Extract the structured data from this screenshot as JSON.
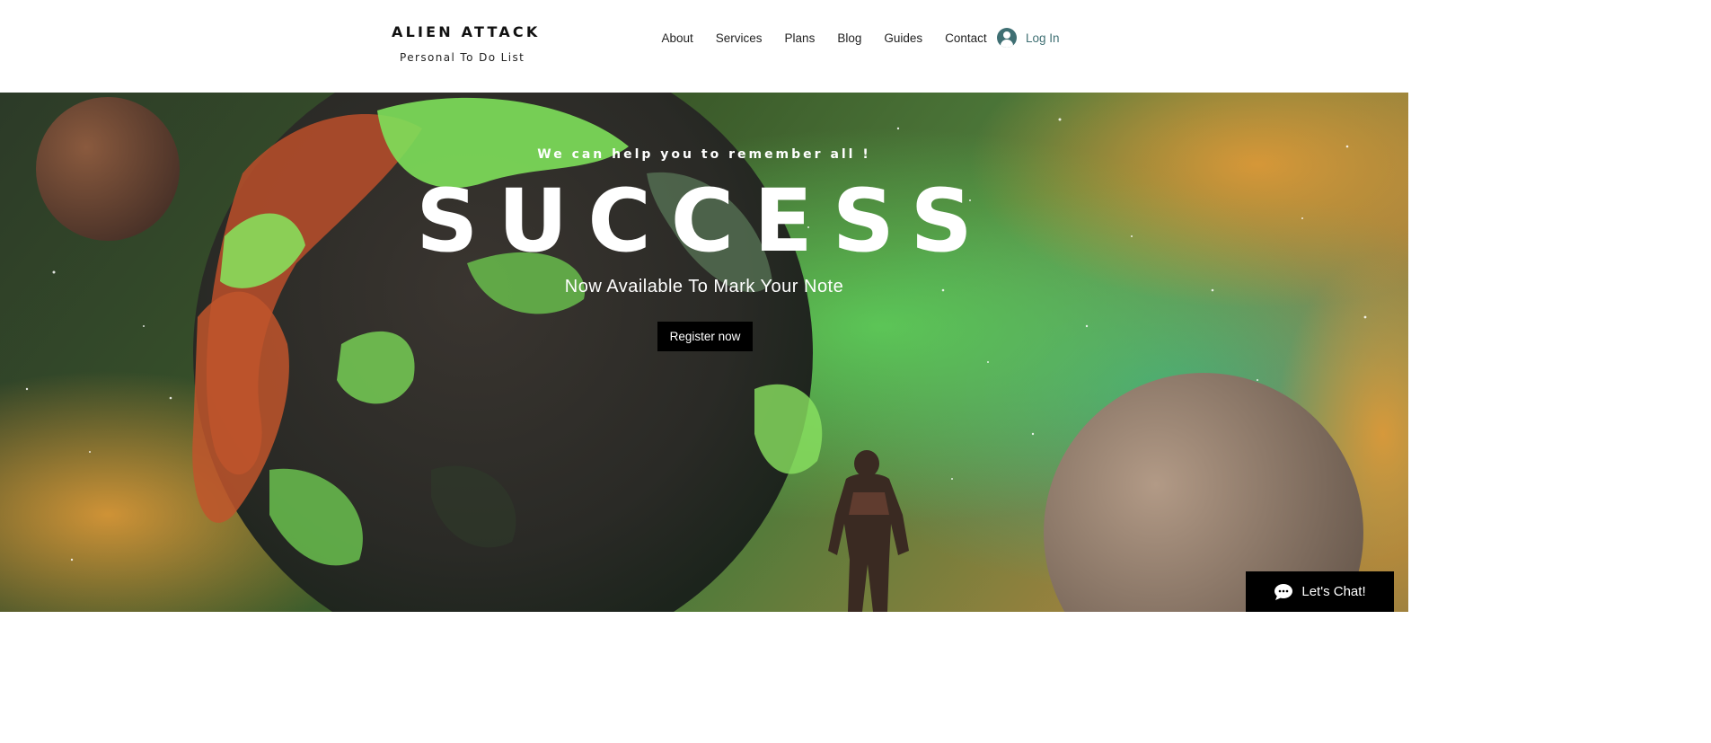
{
  "brand": {
    "title": "ALIEN ATTACK",
    "subtitle": "Personal To Do List"
  },
  "nav": {
    "items": [
      {
        "label": "About"
      },
      {
        "label": "Services"
      },
      {
        "label": "Plans"
      },
      {
        "label": "Blog"
      },
      {
        "label": "Guides"
      },
      {
        "label": "Contact"
      }
    ],
    "login_label": "Log In",
    "login_icon": "user-avatar-icon"
  },
  "hero": {
    "tagline": "We can help you to remember all !",
    "headline": "SUCCESS",
    "subline": "Now Available To Mark Your Note",
    "cta_label": "Register now",
    "background": "space-astronaut-planet-illustration"
  },
  "chat": {
    "label": "Let's Chat!",
    "icon": "chat-bubble-icon"
  },
  "colors": {
    "accent": "#3f6f73",
    "button_bg": "#000000",
    "header_bg": "#ffffff",
    "text_light": "#ffffff"
  }
}
